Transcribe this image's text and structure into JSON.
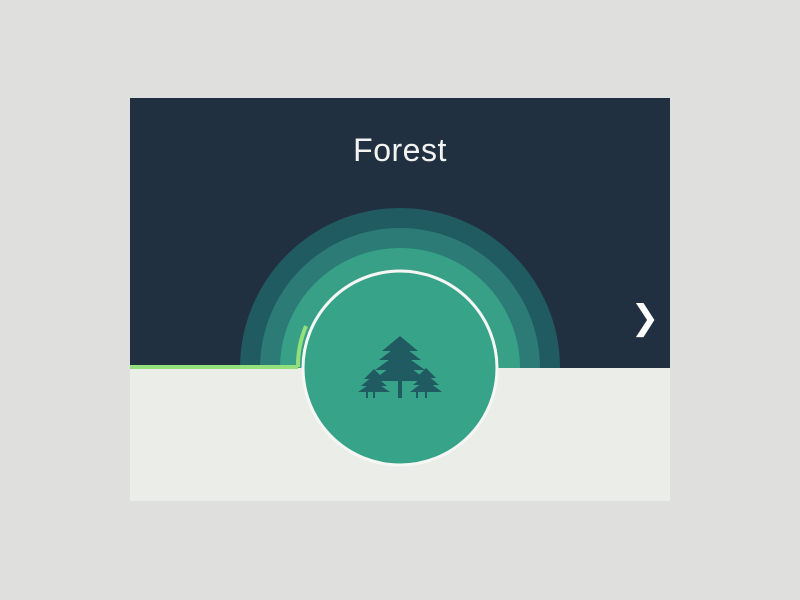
{
  "card": {
    "title": "Forest",
    "icon": "pine-trees-icon",
    "progress": 0.11
  },
  "navigation": {
    "next_icon": "chevron-right-icon",
    "next_glyph": "❯"
  },
  "colors": {
    "page_background": "#dfe0dd",
    "card_top": "#213040",
    "card_bottom": "#ebede8",
    "ring_outer": "#215b62",
    "ring_middle": "#2c7b76",
    "ring_inner": "#37a086",
    "disc": "#37a489",
    "disc_border": "#f6f7f4",
    "tree_icon": "#215b62",
    "progress_line": "#93e07c",
    "title_text": "#f3f4f2"
  }
}
